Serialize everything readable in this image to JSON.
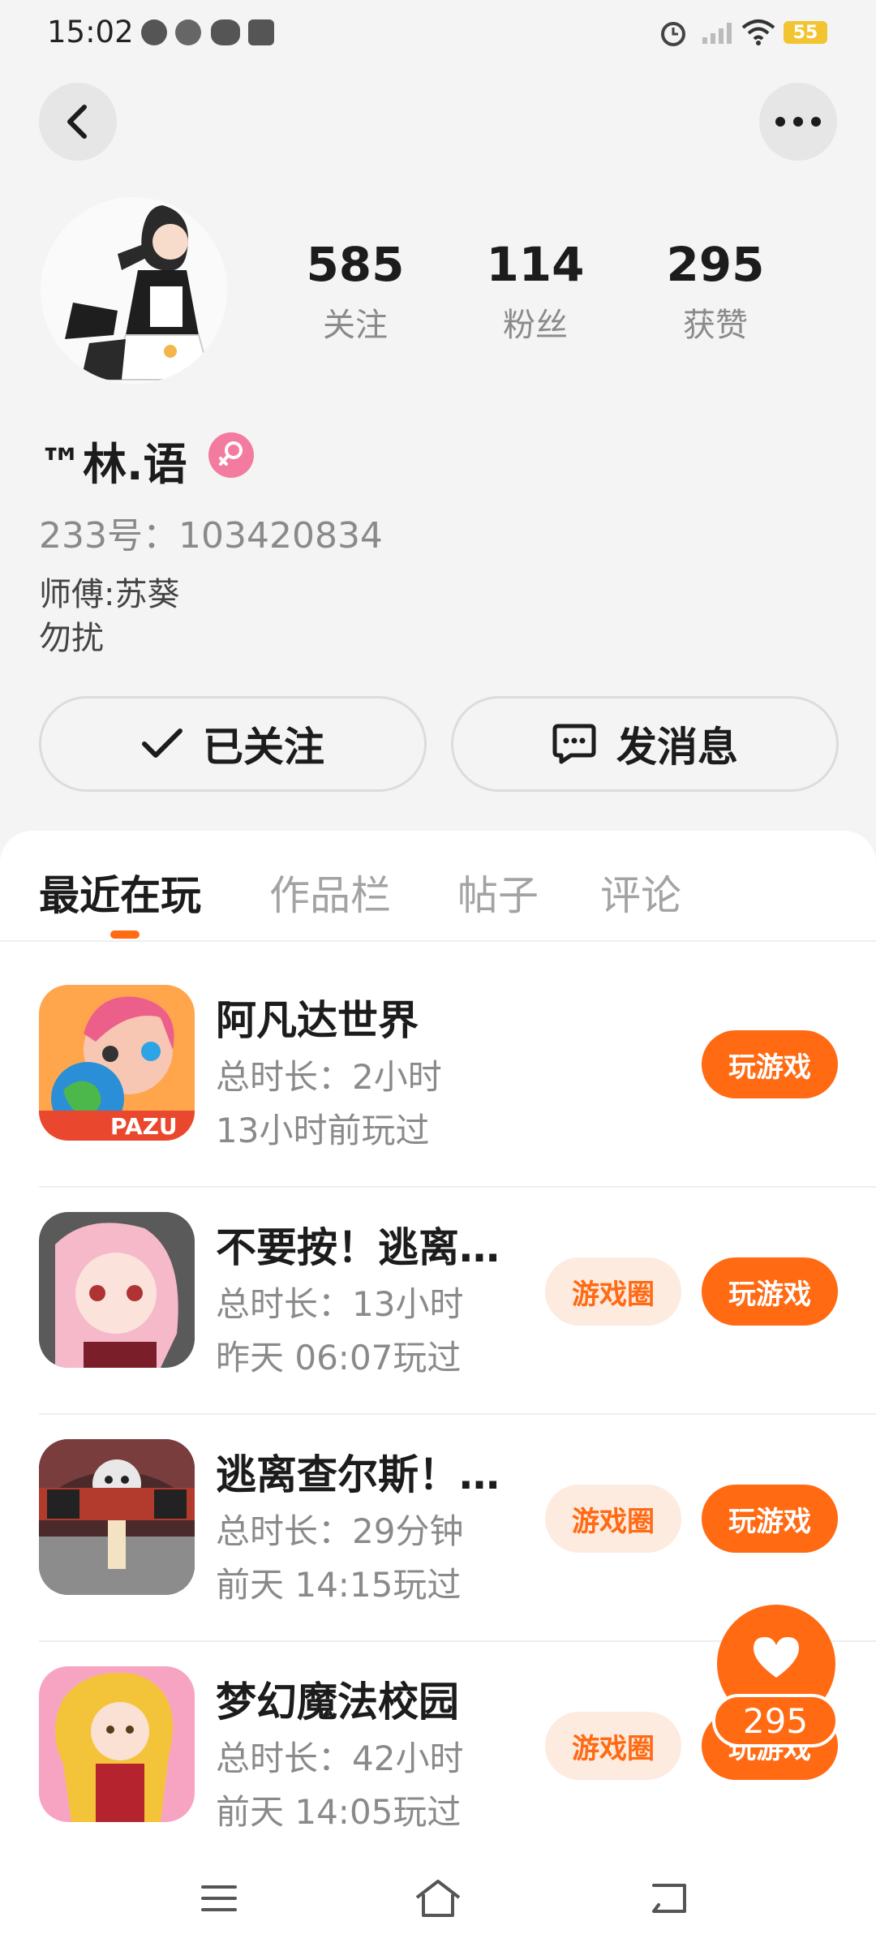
{
  "status_bar": {
    "time": "15:02",
    "battery": "55"
  },
  "profile": {
    "stats": [
      {
        "value": "585",
        "label": "关注"
      },
      {
        "value": "114",
        "label": "粉丝"
      },
      {
        "value": "295",
        "label": "获赞"
      }
    ],
    "username": "™林.语",
    "account_id": "233号：103420834",
    "bio": [
      "师傅:苏葵",
      "勿扰"
    ]
  },
  "actions": {
    "follow_label": "已关注",
    "message_label": "发消息"
  },
  "tabs": [
    "最近在玩",
    "作品栏",
    "帖子",
    "评论"
  ],
  "games": [
    {
      "name": "阿凡达世界",
      "duration": "总时长：2小时",
      "last_played": "13小时前玩过",
      "has_circle": false
    },
    {
      "name": "不要按！逃离…",
      "duration": "总时长：13小时",
      "last_played": "昨天 06:07玩过",
      "has_circle": true
    },
    {
      "name": "逃离查尔斯！…",
      "duration": "总时长：29分钟",
      "last_played": "前天 14:15玩过",
      "has_circle": true
    },
    {
      "name": "梦幻魔法校园",
      "duration": "总时长：42小时",
      "last_played": "前天 14:05玩过",
      "has_circle": true
    }
  ],
  "buttons": {
    "play": "玩游戏",
    "circle": "游戏圈"
  },
  "fab": {
    "like_count": "295"
  },
  "icon_logos": {
    "game_1_logo": "PAZU"
  },
  "colors": {
    "accent": "#ff6a13",
    "accent_soft": "#fdebe0",
    "gender_badge": "#f47ba0"
  }
}
